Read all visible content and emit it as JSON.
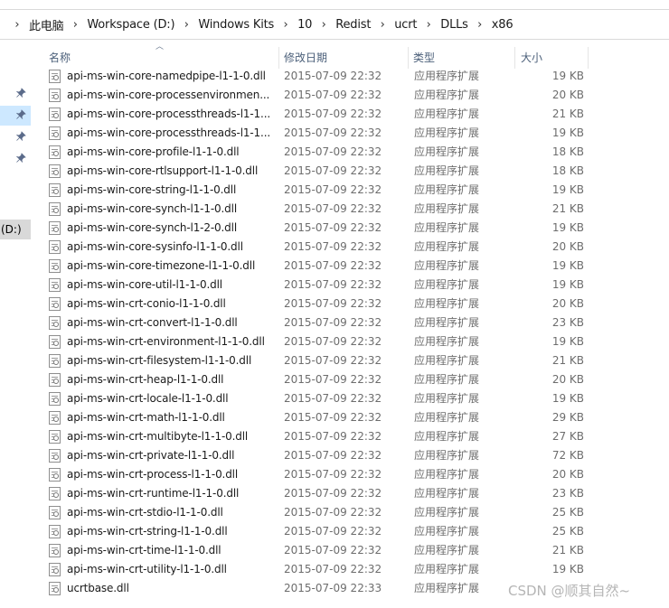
{
  "breadcrumbs": [
    "此电脑",
    "Workspace (D:)",
    "Windows Kits",
    "10",
    "Redist",
    "ucrt",
    "DLLs",
    "x86"
  ],
  "nav": {
    "drive_label": "(D:)"
  },
  "columns": {
    "name": "名称",
    "date": "修改日期",
    "type": "类型",
    "size": "大小"
  },
  "files": [
    {
      "name": "api-ms-win-core-namedpipe-l1-1-0.dll",
      "date": "2015-07-09 22:32",
      "type": "应用程序扩展",
      "size": "19 KB"
    },
    {
      "name": "api-ms-win-core-processenvironmen...",
      "date": "2015-07-09 22:32",
      "type": "应用程序扩展",
      "size": "20 KB"
    },
    {
      "name": "api-ms-win-core-processthreads-l1-1...",
      "date": "2015-07-09 22:32",
      "type": "应用程序扩展",
      "size": "21 KB"
    },
    {
      "name": "api-ms-win-core-processthreads-l1-1...",
      "date": "2015-07-09 22:32",
      "type": "应用程序扩展",
      "size": "19 KB"
    },
    {
      "name": "api-ms-win-core-profile-l1-1-0.dll",
      "date": "2015-07-09 22:32",
      "type": "应用程序扩展",
      "size": "18 KB"
    },
    {
      "name": "api-ms-win-core-rtlsupport-l1-1-0.dll",
      "date": "2015-07-09 22:32",
      "type": "应用程序扩展",
      "size": "18 KB"
    },
    {
      "name": "api-ms-win-core-string-l1-1-0.dll",
      "date": "2015-07-09 22:32",
      "type": "应用程序扩展",
      "size": "19 KB"
    },
    {
      "name": "api-ms-win-core-synch-l1-1-0.dll",
      "date": "2015-07-09 22:32",
      "type": "应用程序扩展",
      "size": "21 KB"
    },
    {
      "name": "api-ms-win-core-synch-l1-2-0.dll",
      "date": "2015-07-09 22:32",
      "type": "应用程序扩展",
      "size": "19 KB"
    },
    {
      "name": "api-ms-win-core-sysinfo-l1-1-0.dll",
      "date": "2015-07-09 22:32",
      "type": "应用程序扩展",
      "size": "20 KB"
    },
    {
      "name": "api-ms-win-core-timezone-l1-1-0.dll",
      "date": "2015-07-09 22:32",
      "type": "应用程序扩展",
      "size": "19 KB"
    },
    {
      "name": "api-ms-win-core-util-l1-1-0.dll",
      "date": "2015-07-09 22:32",
      "type": "应用程序扩展",
      "size": "19 KB"
    },
    {
      "name": "api-ms-win-crt-conio-l1-1-0.dll",
      "date": "2015-07-09 22:32",
      "type": "应用程序扩展",
      "size": "20 KB"
    },
    {
      "name": "api-ms-win-crt-convert-l1-1-0.dll",
      "date": "2015-07-09 22:32",
      "type": "应用程序扩展",
      "size": "23 KB"
    },
    {
      "name": "api-ms-win-crt-environment-l1-1-0.dll",
      "date": "2015-07-09 22:32",
      "type": "应用程序扩展",
      "size": "19 KB"
    },
    {
      "name": "api-ms-win-crt-filesystem-l1-1-0.dll",
      "date": "2015-07-09 22:32",
      "type": "应用程序扩展",
      "size": "21 KB"
    },
    {
      "name": "api-ms-win-crt-heap-l1-1-0.dll",
      "date": "2015-07-09 22:32",
      "type": "应用程序扩展",
      "size": "20 KB"
    },
    {
      "name": "api-ms-win-crt-locale-l1-1-0.dll",
      "date": "2015-07-09 22:32",
      "type": "应用程序扩展",
      "size": "19 KB"
    },
    {
      "name": "api-ms-win-crt-math-l1-1-0.dll",
      "date": "2015-07-09 22:32",
      "type": "应用程序扩展",
      "size": "29 KB"
    },
    {
      "name": "api-ms-win-crt-multibyte-l1-1-0.dll",
      "date": "2015-07-09 22:32",
      "type": "应用程序扩展",
      "size": "27 KB"
    },
    {
      "name": "api-ms-win-crt-private-l1-1-0.dll",
      "date": "2015-07-09 22:32",
      "type": "应用程序扩展",
      "size": "72 KB"
    },
    {
      "name": "api-ms-win-crt-process-l1-1-0.dll",
      "date": "2015-07-09 22:32",
      "type": "应用程序扩展",
      "size": "20 KB"
    },
    {
      "name": "api-ms-win-crt-runtime-l1-1-0.dll",
      "date": "2015-07-09 22:32",
      "type": "应用程序扩展",
      "size": "23 KB"
    },
    {
      "name": "api-ms-win-crt-stdio-l1-1-0.dll",
      "date": "2015-07-09 22:32",
      "type": "应用程序扩展",
      "size": "25 KB"
    },
    {
      "name": "api-ms-win-crt-string-l1-1-0.dll",
      "date": "2015-07-09 22:32",
      "type": "应用程序扩展",
      "size": "25 KB"
    },
    {
      "name": "api-ms-win-crt-time-l1-1-0.dll",
      "date": "2015-07-09 22:32",
      "type": "应用程序扩展",
      "size": "21 KB"
    },
    {
      "name": "api-ms-win-crt-utility-l1-1-0.dll",
      "date": "2015-07-09 22:32",
      "type": "应用程序扩展",
      "size": "19 KB"
    },
    {
      "name": "ucrtbase.dll",
      "date": "2015-07-09 22:33",
      "type": "应用程序扩展",
      "size": ""
    }
  ],
  "watermark": "CSDN @顺其自然~"
}
